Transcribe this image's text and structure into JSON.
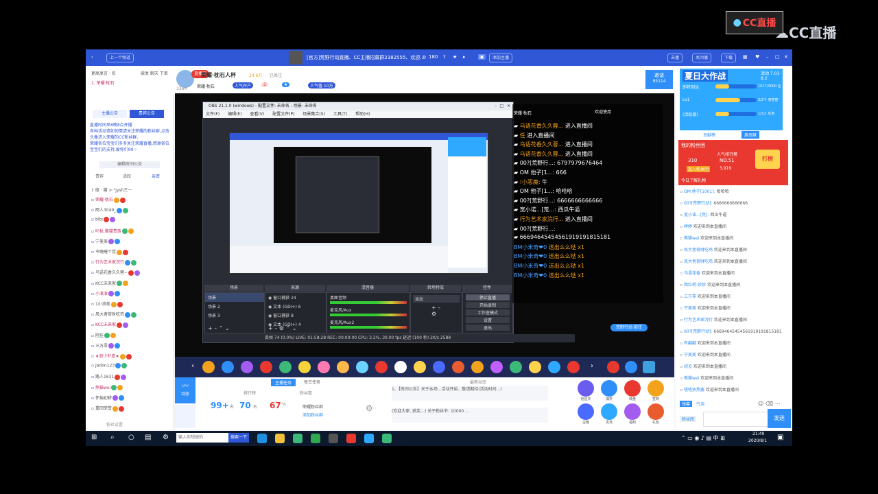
{
  "watermark": {
    "brand_box": "CC直播",
    "brand_big": "CC直播"
  },
  "titlebar": {
    "back": "上一个频道",
    "channel": "[官方]荒野行动直播、CC主播招募群2382555、欢迎...",
    "viewers": "180",
    "join": "添加主播",
    "btn1": "去播",
    "btn2": "关闭播",
    "btn3": "下载"
  },
  "left": {
    "top_row": "更高发言  ·  名",
    "top_row2": "欲发 聊天 下单",
    "host_row": "1. 荣耀·枕石",
    "tab_a": "主播公告",
    "tab_b": "贵宾公告",
    "notice": "直播时间早8晚8点开播\n各种活动请如何情请关注荣耀的粉丝群,点击头像进入荣耀的CC粉丝群,\n荣耀各位宝宝们多多关注荣耀直播,感谢各位宝宝们的支持,爱你们99♡",
    "edit_notice": "编辑房间公告",
    "subtabs": [
      "贵宾",
      "活跃",
      "亲密"
    ],
    "list_header": "1 级  ·  猫 >·°jysh三一",
    "fans": [
      "荣耀·枕石",
      "雨人3049_",
      "bibi",
      "叶秋.聚猫贵族",
      "宁美美",
      "今晚睡个觉",
      "行为艺术家浣行",
      "乌语花香久久蓉~",
      "KCC未来家",
      "小浪浪",
      "1小浪美",
      "风大者荷财吃鸡",
      "KCC未来家",
      "阻挂",
      "三万零",
      "★浪少朴皮★",
      "Jadon123",
      "路人1631",
      "熊猫wei",
      "怀揣初耕",
      "重回荣誉"
    ],
    "footer": "粉丝设置"
  },
  "header": {
    "host_name": "荣耀·枕石人杯",
    "heat": "24.6万",
    "follow": "已关注",
    "live_tag": "直播中",
    "room_id": "3364",
    "tag1": "荣耀·枕石",
    "tag2": "人气开户",
    "tag3": "2",
    "tag4": "人气值 10万",
    "invite": "邀请",
    "invite_count": "95114"
  },
  "obs": {
    "title": "OBS 21.1.0 (windows) - 配置文件: 未命名 - 场景: 未命名",
    "menu": [
      "文件(F)",
      "编辑(E)",
      "查看(V)",
      "配置文件(P)",
      "场景集合(S)",
      "工具(T)",
      "帮助(H)"
    ],
    "panels": [
      "场景",
      "来源",
      "混音器",
      "转场特效",
      "控件"
    ],
    "scenes": [
      "场景",
      "场景 2",
      "场景 3"
    ],
    "sources": [
      "窗口捕获 24",
      "文本 (GDI+) 6",
      "窗口捕获 8",
      "文本 (GDI+) 4"
    ],
    "mixer": [
      "桌面音频",
      "麦克风/Aux",
      "麦克风/Aux2"
    ],
    "transition": "淡出",
    "controls": [
      "停止直播",
      "开始录制",
      "工作室模式",
      "设置",
      "退出"
    ],
    "status": "丢帧 74 (0.0%)    LIVE: 01:58:28    REC: 00:00:00    CPU: 3.2%, 30.00 fps    延迟 (100 秒)    2K/s    2588"
  },
  "chat": {
    "header": "荣耀·枕石",
    "header2": "欢迎使用",
    "lines": [
      {
        "name": "乌语花香久久蓉...",
        "msg": " 进入直播间"
      },
      {
        "name": "任",
        "msg": " 进入直播间"
      },
      {
        "name": "乌语花香久久蓉...",
        "msg": " 进入直播间"
      },
      {
        "name": "乌语花香久久蓉...",
        "msg": " 进入直播间"
      },
      {
        "name": "00?[荒野行...:",
        "msg": " 6797979676464"
      },
      {
        "name": "OM 他子[1...:",
        "msg": " 666"
      },
      {
        "name": "!小恶魔:",
        "msg": " 牛"
      },
      {
        "name": "OM 他子[1...:",
        "msg": " 哈哈哈"
      },
      {
        "name": "00?[荒野行...:",
        "msg": " 6666666666666"
      },
      {
        "name": "宽小诺...[荒...:",
        "msg": " 西瓜牛逼"
      },
      {
        "name": "行为艺术家浣行...",
        "msg": " 进入直播间"
      },
      {
        "name": "00?[荒野行...:",
        "msg": ""
      },
      {
        "name": "",
        "msg": "66694645454561919191815181"
      },
      {
        "name": "BM小米奇❤0",
        "msg": " 送出么么哒 x1"
      },
      {
        "name": "BM小米奇❤0",
        "msg": " 送出么么哒 x1"
      },
      {
        "name": "BM小米奇❤0",
        "msg": " 送出么么哒 x1"
      },
      {
        "name": "BM小米奇❤0",
        "msg": " 送出么么哒 x1"
      }
    ],
    "game_btn": "荒野行动·前往"
  },
  "bottom": {
    "btn_left": "动态",
    "tab1": "主播任务",
    "tab2": "每日任务",
    "rank_title": "排行榜",
    "fans_title": "粉丝数",
    "stat1": "99+",
    "stat1_unit": "名",
    "stat2": "70",
    "stat2_unit": "名",
    "stat3": "67",
    "stat3_unit": "%",
    "fans_text": "荣耀粉丝群",
    "fans_btn": "添加粉丝群",
    "notice_title": "最新动态",
    "notice1": "1、【房间公告】关于本场...活动开始...敬请期待(活动时间...)",
    "notice2": "(欢迎大家..获奖...) 关于粉丝节: 10000 ...",
    "games": [
      "抢星天",
      "抽奖",
      "转盘",
      "签到",
      "宝箱",
      "贵宾",
      "福利",
      "礼包"
    ]
  },
  "right": {
    "banner": "夏日大作战",
    "banner_sub": "活动 7.01-8.2",
    "progress": [
      {
        "label": "即将到达",
        "value": "1017/3000 名",
        "frac": 0.34
      },
      {
        "label": "Lv1",
        "value": "3/2个 亲密度",
        "frac": 0.6
      },
      {
        "label": "(活跃度)",
        "value": "1/3人 任务",
        "frac": 0.33
      }
    ],
    "tab_a": "贡献榜",
    "tab_b": "周贡献",
    "fans_box_title": "我的粉丝团",
    "fans_level": "310",
    "fans_rank": "NO.51",
    "fans_week": "3,919",
    "fans_week_label": "人气排行榜",
    "fans_btn": "加入粉丝团",
    "fans_action": "打榜",
    "fans_footer": "今日了解礼物",
    "feed": [
      {
        "name": "OM 他子[1001]:",
        "msg": " 哈哈哈"
      },
      {
        "name": "00?[荒野行动]:",
        "msg": " 6666666666666"
      },
      {
        "name": "宽小诺...[荒]:",
        "msg": " 西瓜牛逼"
      },
      {
        "name": "婷婷",
        "msg": " 欢迎来到本直播间"
      },
      {
        "name": "熊猫wei",
        "msg": " 欢迎来到本直播间"
      },
      {
        "name": "风大者荷财吃鸡",
        "msg": " 欢迎来到本直播间"
      },
      {
        "name": "风大者荷财吃鸡",
        "msg": " 欢迎来到本直播间"
      },
      {
        "name": "乌语花香",
        "msg": " 欢迎来到本直播间"
      },
      {
        "name": "西红柿-妙妙",
        "msg": " 欢迎来到本直播间"
      },
      {
        "name": "三万零",
        "msg": " 欢迎来到本直播间"
      },
      {
        "name": "宁美美",
        "msg": " 欢迎来到本直播间"
      },
      {
        "name": "行为艺术家浣行",
        "msg": " 欢迎来到本直播间"
      },
      {
        "name": "00?[荒野行动]:",
        "msg": " 66694645454561919191815181"
      },
      {
        "name": "有翻翻",
        "msg": " 欢迎来到本直播间"
      },
      {
        "name": "宁美美",
        "msg": " 欢迎来到本直播间"
      },
      {
        "name": "初见",
        "msg": " 欢迎来到本直播间"
      },
      {
        "name": "熊猫wei",
        "msg": " 欢迎来到本直播间"
      },
      {
        "name": "嗒嗒执熬酱",
        "msg": " 欢迎来到本直播间"
      }
    ],
    "input_tab1": "弹幕",
    "input_tab2": "气泡",
    "send": "发送",
    "fans_chip": "粉丝团"
  },
  "taskbar": {
    "search_placeholder": "输入你想搜的",
    "search_btn": "搜索一下",
    "time": "21:49",
    "date": "2020/8/1"
  },
  "colors": {
    "accent": "#2f57d6",
    "live_red": "#e8382f",
    "gold": "#f3a21b"
  }
}
